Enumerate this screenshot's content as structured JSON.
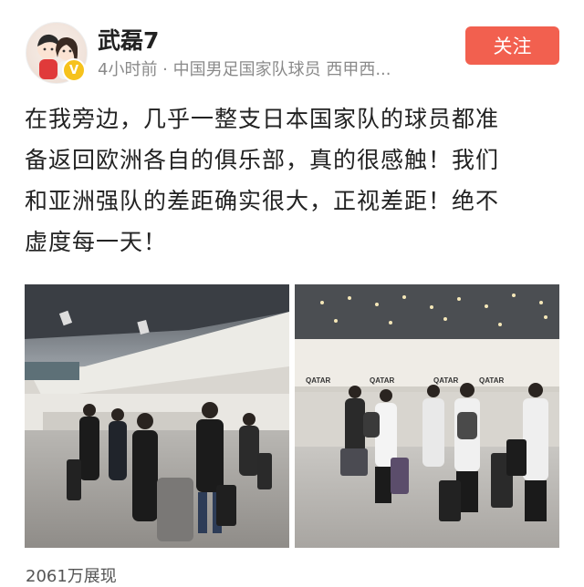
{
  "user": {
    "name": "武磊7",
    "meta": "4小时前 · 中国男足国家队球员 西甲西...",
    "verified_icon": "verified-badge-icon",
    "verified_mark": "V"
  },
  "follow_button": {
    "label": "关注",
    "color": "#f2604f"
  },
  "post": {
    "lines": [
      "在我旁边，几乎一整支日本国家队的球员都准",
      "备返回欧洲各自的俱乐部，真的很感触！我们",
      "和亚洲强队的差距确实很大，正视差距！绝不",
      "虚度每一天！"
    ]
  },
  "photos": [
    {
      "signs": []
    },
    {
      "signs": [
        "QATAR",
        "QATAR",
        "QATAR",
        "QATAR"
      ]
    }
  ],
  "stats": {
    "views": "2061万展现"
  }
}
